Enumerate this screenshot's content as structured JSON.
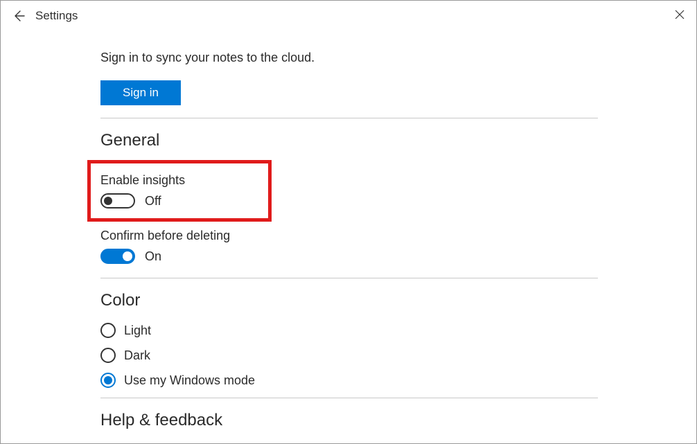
{
  "titlebar": {
    "title": "Settings"
  },
  "signin": {
    "message": "Sign in to sync your notes to the cloud.",
    "button": "Sign in"
  },
  "sections": {
    "general": {
      "heading": "General",
      "insights": {
        "label": "Enable insights",
        "state": "Off",
        "on": false
      },
      "confirm_delete": {
        "label": "Confirm before deleting",
        "state": "On",
        "on": true
      }
    },
    "color": {
      "heading": "Color",
      "options": {
        "light": "Light",
        "dark": "Dark",
        "windows": "Use my Windows mode"
      },
      "selected": "windows"
    },
    "help": {
      "heading": "Help & feedback"
    }
  }
}
